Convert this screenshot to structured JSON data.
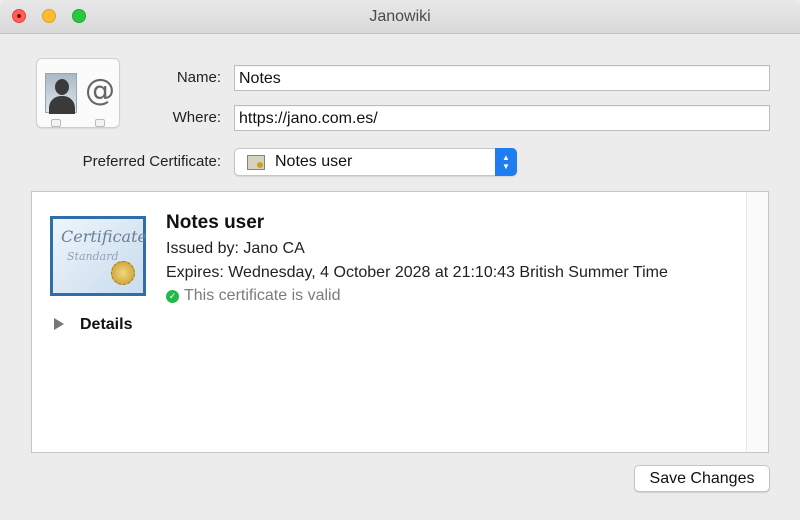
{
  "window": {
    "title": "Janowiki"
  },
  "form": {
    "name_label": "Name:",
    "name_value": "Notes",
    "where_label": "Where:",
    "where_value": "https://jano.com.es/",
    "preferred_label": "Preferred Certificate:",
    "preferred_value": "Notes user"
  },
  "certificate": {
    "name": "Notes user",
    "issued_by": "Issued by: Jano CA",
    "expires": "Expires: Wednesday, 4 October 2028 at 21:10:43 British Summer Time",
    "status": "This certificate is valid",
    "image_text": "Certificate",
    "image_subtext": "Standard"
  },
  "details": {
    "label": "Details"
  },
  "actions": {
    "save_label": "Save Changes"
  },
  "icons": {
    "close": "close-icon",
    "minimize": "minimize-icon",
    "maximize": "maximize-icon",
    "contact": "contact-card-icon",
    "certificate": "certificate-icon",
    "valid": "checkmark-circle-icon",
    "disclosure": "disclosure-triangle-icon"
  },
  "colors": {
    "accent": "#1f7cf1",
    "valid_green": "#25b84a",
    "traffic_close": "#fe5f57",
    "traffic_min": "#febc2e",
    "traffic_max": "#28c840"
  }
}
